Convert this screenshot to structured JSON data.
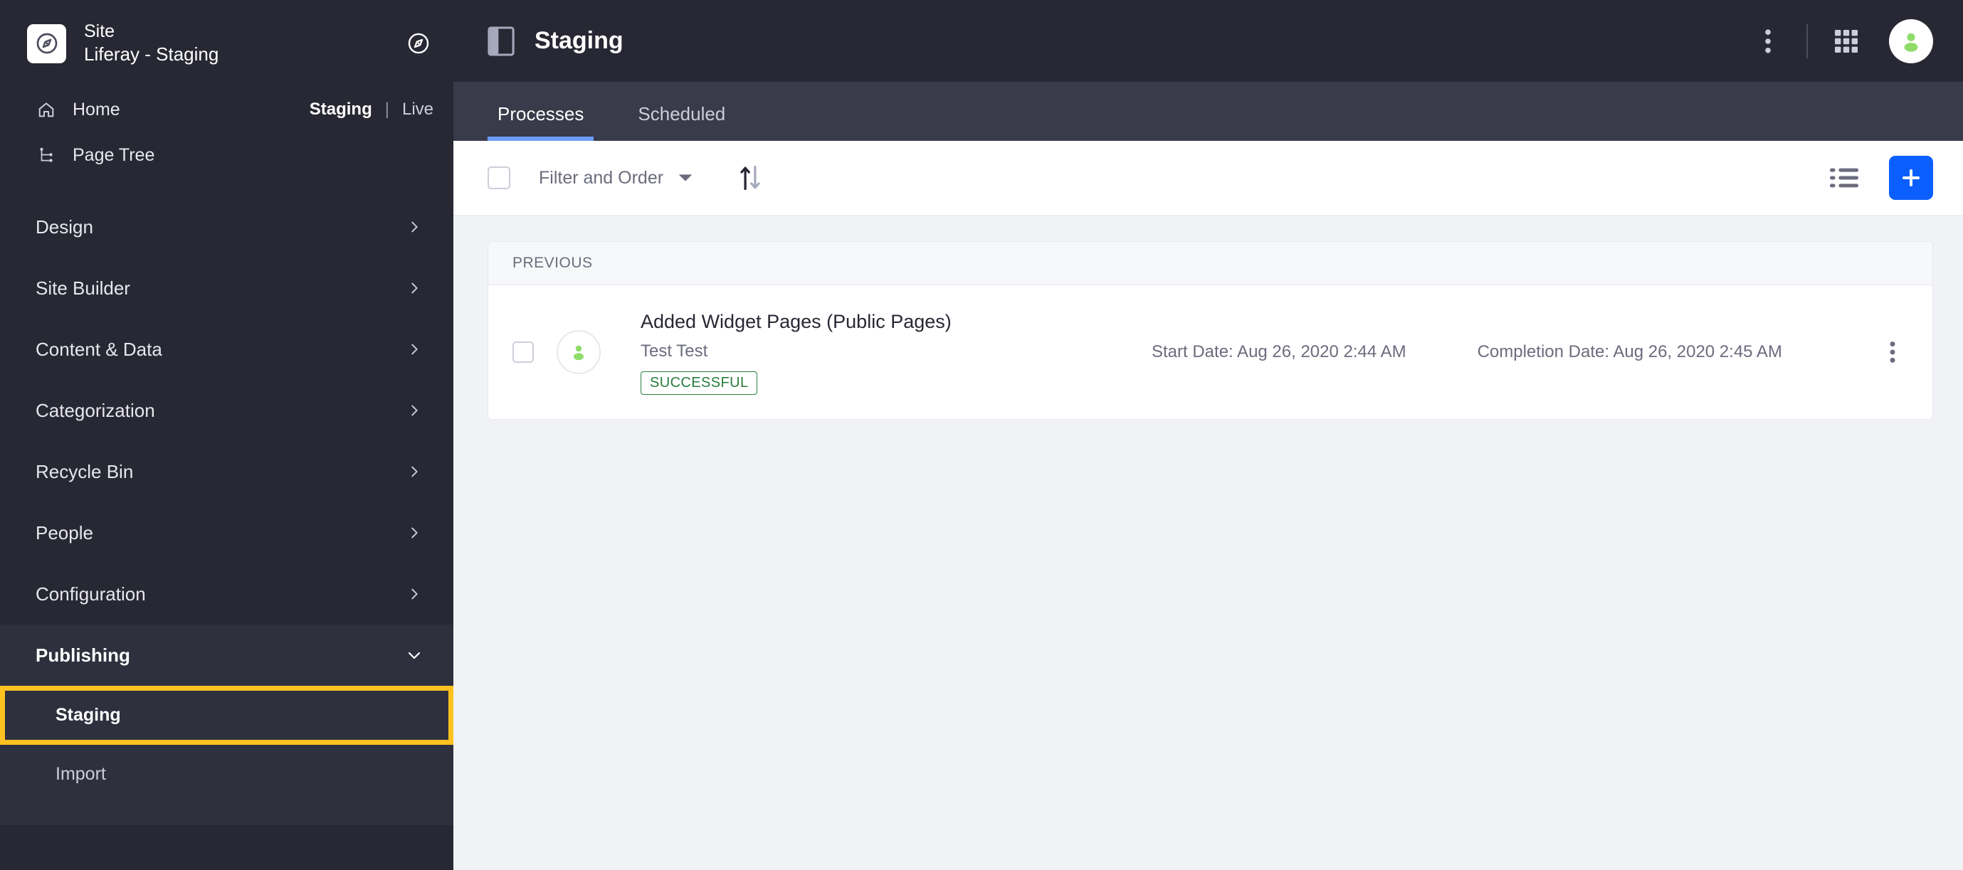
{
  "sidebar": {
    "logo_icon": "compass-icon",
    "site_kicker": "Site",
    "site_title": "Liferay - Staging",
    "header_compass_icon": "compass-icon",
    "quick_items": [
      {
        "label": "Home",
        "icon": "home-icon"
      },
      {
        "label": "Page Tree",
        "icon": "page-tree-icon"
      }
    ],
    "stage_toggle": {
      "active": "Staging",
      "separator": "|",
      "inactive": "Live"
    },
    "sections": [
      {
        "label": "Design",
        "expanded": false,
        "icon": "chevron-right-icon"
      },
      {
        "label": "Site Builder",
        "expanded": false,
        "icon": "chevron-right-icon"
      },
      {
        "label": "Content & Data",
        "expanded": false,
        "icon": "chevron-right-icon"
      },
      {
        "label": "Categorization",
        "expanded": false,
        "icon": "chevron-right-icon"
      },
      {
        "label": "Recycle Bin",
        "expanded": false,
        "icon": "chevron-right-icon"
      },
      {
        "label": "People",
        "expanded": false,
        "icon": "chevron-right-icon"
      },
      {
        "label": "Configuration",
        "expanded": false,
        "icon": "chevron-right-icon"
      },
      {
        "label": "Publishing",
        "expanded": true,
        "icon": "chevron-down-icon"
      }
    ],
    "publishing_children": [
      {
        "label": "Staging",
        "selected": true
      },
      {
        "label": "Import",
        "selected": false
      }
    ],
    "highlight_color": "#ffc220"
  },
  "topbar": {
    "panel_toggle_icon": "side-panel-toggle-icon",
    "title": "Staging",
    "kebab_icon": "vertical-kebab-icon",
    "apps_icon": "app-grid-icon",
    "avatar_icon": "user-avatar-icon"
  },
  "tabs": [
    {
      "label": "Processes",
      "active": true
    },
    {
      "label": "Scheduled",
      "active": false
    }
  ],
  "toolbar": {
    "select_all_checkbox": "unchecked",
    "filter_label": "Filter and Order",
    "caret_icon": "caret-down-icon",
    "sort_icon": "sort-arrows-icon",
    "list_view_icon": "list-view-icon",
    "add_label": "+",
    "add_color": "#0b5fff"
  },
  "list": {
    "group_header": "PREVIOUS",
    "rows": [
      {
        "checkbox": "unchecked",
        "avatar_icon": "user-icon",
        "title": "Added Widget Pages (Public Pages)",
        "subtitle": "Test Test",
        "status": "SUCCESSFUL",
        "status_color": "#287d3c",
        "start_date": "Start Date: Aug 26, 2020 2:44 AM",
        "completion_date": "Completion Date: Aug 26, 2020 2:45 AM",
        "kebab_icon": "vertical-kebab-icon"
      }
    ]
  }
}
